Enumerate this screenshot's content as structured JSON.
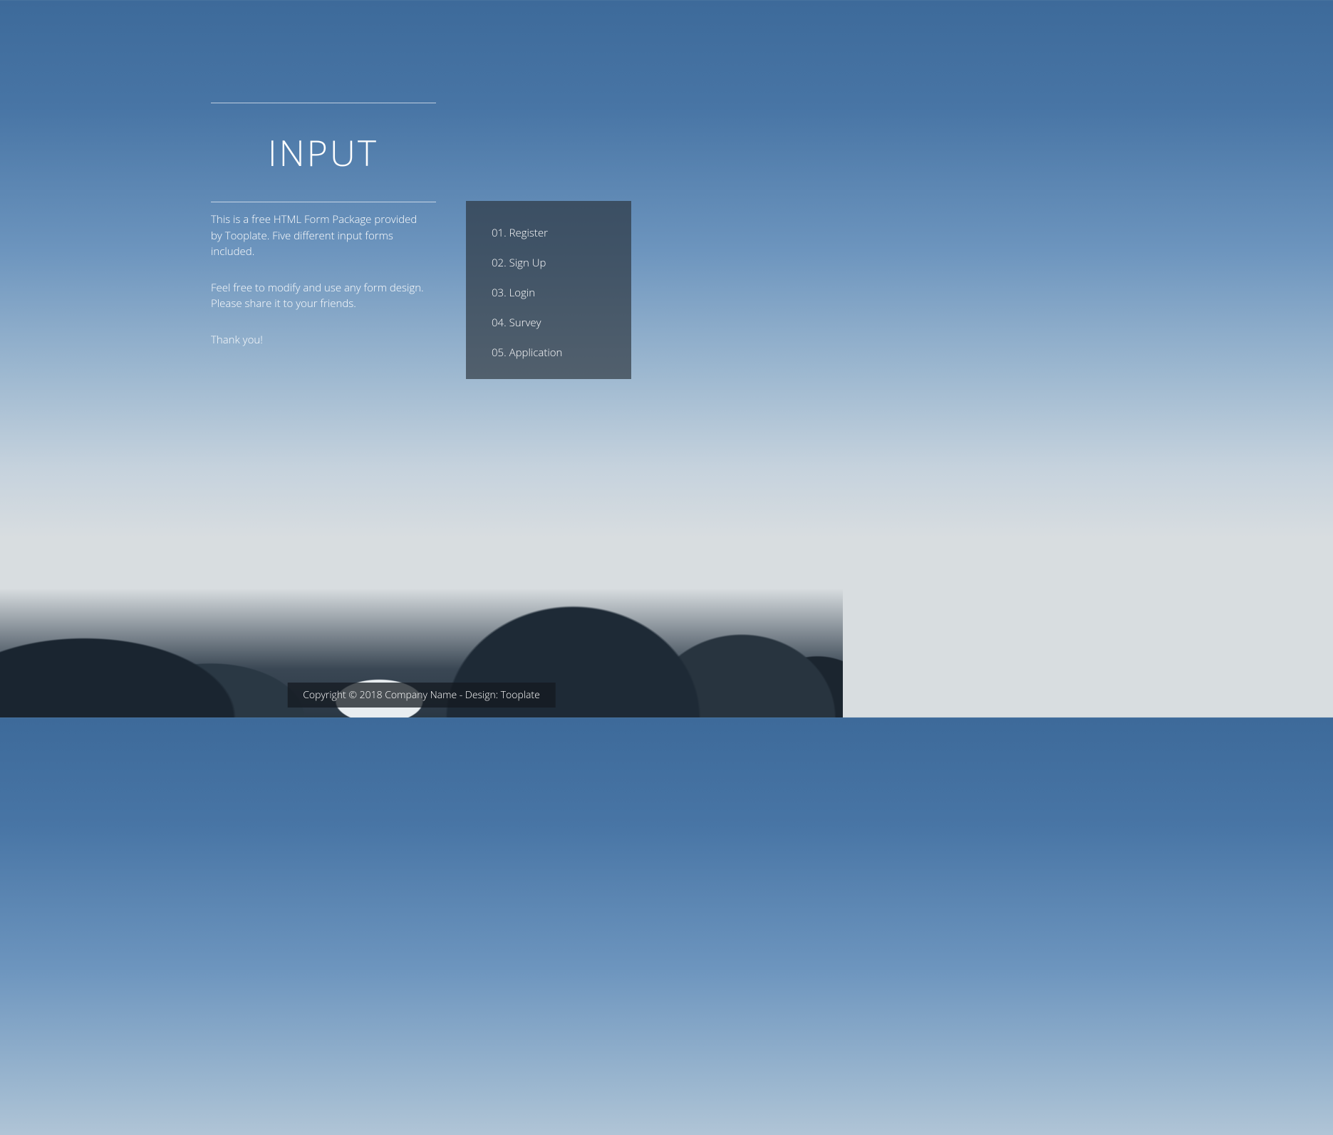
{
  "title": "INPUT",
  "description": {
    "p1": "This is a free HTML Form Package provided by Tooplate. Five different input forms included.",
    "p2": "Feel free to modify and use any form design. Please share it to your friends.",
    "p3": "Thank you!"
  },
  "nav": {
    "items": [
      {
        "label": "01. Register"
      },
      {
        "label": "02. Sign Up"
      },
      {
        "label": "03. Login"
      },
      {
        "label": "04. Survey"
      },
      {
        "label": "05. Application"
      }
    ]
  },
  "footer": {
    "copyright_prefix": "Copyright © 2018 Company Name - Design: ",
    "design_link_text": "Tooplate"
  }
}
